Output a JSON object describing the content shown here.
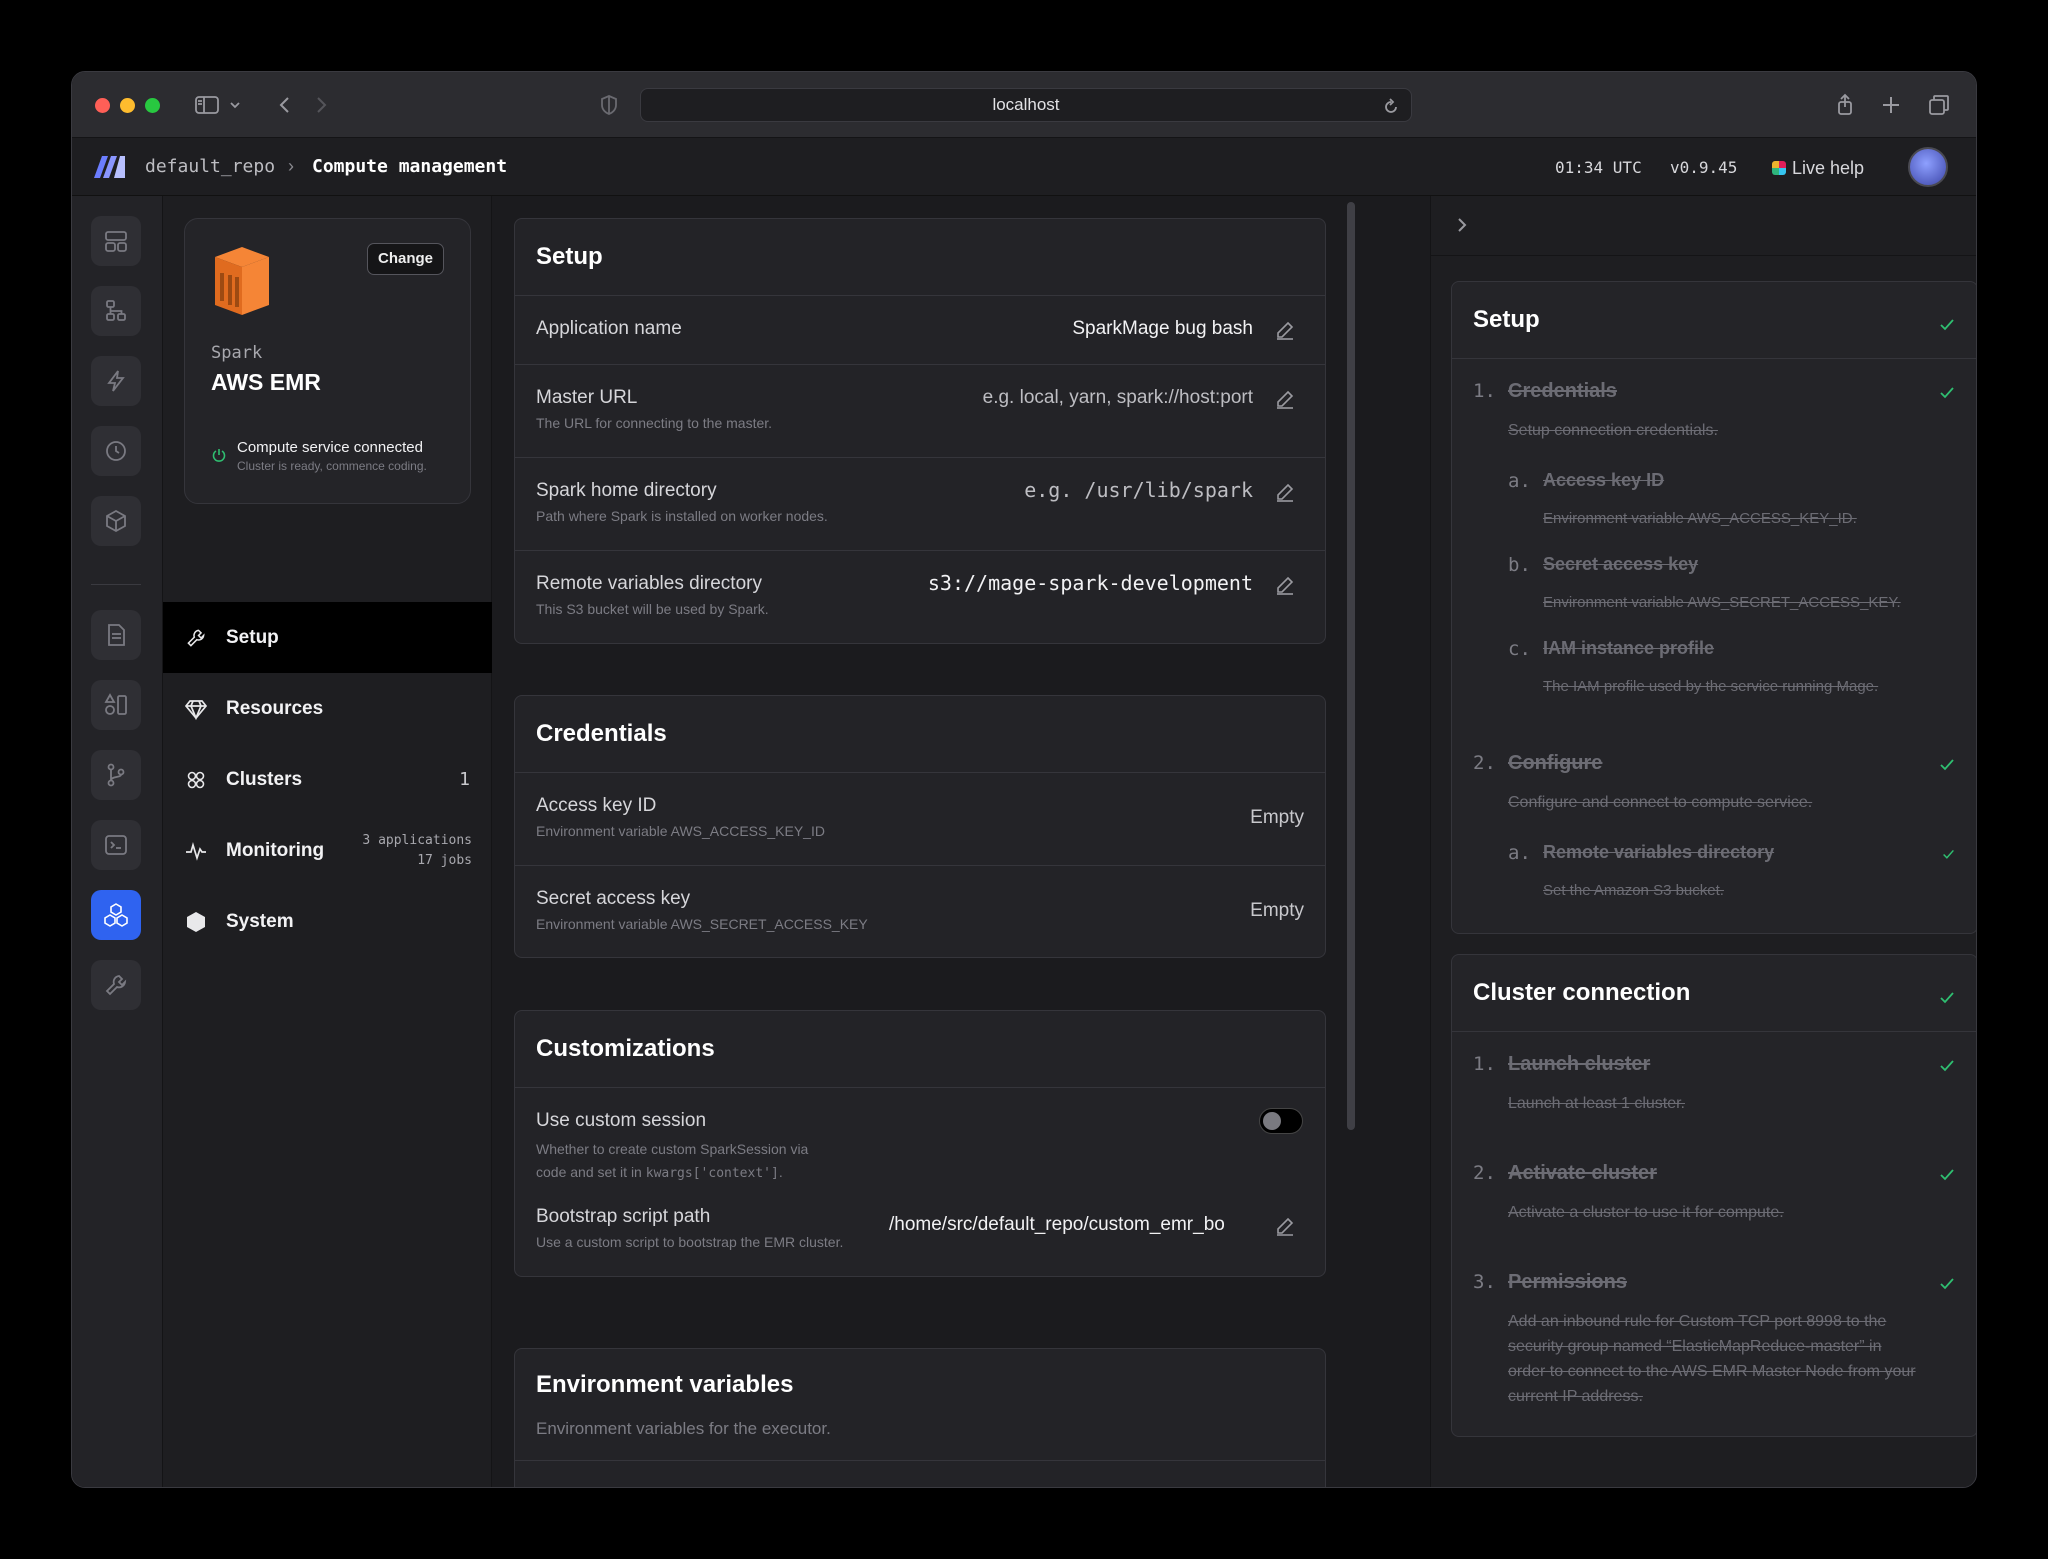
{
  "browser": {
    "url": "localhost"
  },
  "header": {
    "repo": "default_repo",
    "page": "Compute management",
    "time": "01:34 UTC",
    "version": "v0.9.45",
    "help": "Live help"
  },
  "service": {
    "change_label": "Change",
    "subtitle": "Spark",
    "title": "AWS EMR",
    "status": "Compute service connected",
    "status_sub": "Cluster is ready, commence coding."
  },
  "nav": {
    "setup": "Setup",
    "resources": "Resources",
    "clusters": "Clusters",
    "clusters_count": "1",
    "monitoring": "Monitoring",
    "monitoring_apps": "3 applications",
    "monitoring_jobs": "17 jobs",
    "system": "System"
  },
  "setup": {
    "title": "Setup",
    "app_name_label": "Application name",
    "app_name_value": "SparkMage bug bash",
    "master_label": "Master URL",
    "master_desc": "The URL for connecting to the master.",
    "master_placeholder": "e.g. local, yarn, spark://host:port",
    "home_label": "Spark home directory",
    "home_desc": "Path where Spark is installed on worker nodes.",
    "home_placeholder": "e.g. /usr/lib/spark",
    "remote_label": "Remote variables directory",
    "remote_desc": "This S3 bucket will be used by Spark.",
    "remote_value": "s3://mage-spark-development"
  },
  "credentials": {
    "title": "Credentials",
    "access_label": "Access key ID",
    "access_desc": "Environment variable AWS_ACCESS_KEY_ID",
    "access_value": "Empty",
    "secret_label": "Secret access key",
    "secret_desc": "Environment variable AWS_SECRET_ACCESS_KEY",
    "secret_value": "Empty"
  },
  "customizations": {
    "title": "Customizations",
    "session_label": "Use custom session",
    "session_desc_1": "Whether to create custom SparkSession via",
    "session_desc_2": "code and set it in",
    "session_desc_code": "kwargs['context']",
    "session_desc_end": ".",
    "session_enabled": false,
    "bootstrap_label": "Bootstrap script path",
    "bootstrap_desc": "Use a custom script to bootstrap the EMR cluster.",
    "bootstrap_value": "/home/src/default_repo/custom_emr_bo"
  },
  "env": {
    "title": "Environment variables",
    "desc": "Environment variables for the executor."
  },
  "checklist_setup": {
    "title": "Setup",
    "s1_num": "1.",
    "s1_title": "Credentials",
    "s1_desc": "Setup connection credentials.",
    "s1a_num": "a.",
    "s1a_title": "Access key ID",
    "s1a_desc": "Environment variable AWS_ACCESS_KEY_ID.",
    "s1b_num": "b.",
    "s1b_title": "Secret access key",
    "s1b_desc": "Environment variable AWS_SECRET_ACCESS_KEY.",
    "s1c_num": "c.",
    "s1c_title": "IAM instance profile",
    "s1c_desc": "The IAM profile used by the service running Mage.",
    "s2_num": "2.",
    "s2_title": "Configure",
    "s2_desc": "Configure and connect to compute service.",
    "s2a_num": "a.",
    "s2a_title": "Remote variables directory",
    "s2a_desc": "Set the Amazon S3 bucket."
  },
  "checklist_cluster": {
    "title": "Cluster connection",
    "c1_num": "1.",
    "c1_title": "Launch cluster",
    "c1_desc": "Launch at least 1 cluster.",
    "c2_num": "2.",
    "c2_title": "Activate cluster",
    "c2_desc": "Activate a cluster to use it for compute.",
    "c3_num": "3.",
    "c3_title": "Permissions",
    "c3_desc_1": "Add an inbound rule for Custom TCP port 8998 to the",
    "c3_desc_2": "security group named “ElasticMapReduce-master” in",
    "c3_desc_3": "order to connect to the AWS EMR Master Node from your",
    "c3_desc_4": "current IP address."
  }
}
